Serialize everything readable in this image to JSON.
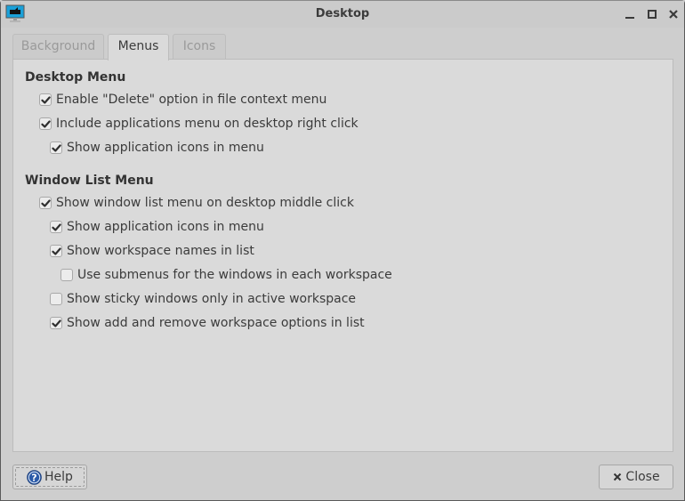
{
  "window": {
    "title": "Desktop",
    "app_icon": "desktop-monitor-icon",
    "controls": [
      "minimize-icon",
      "maximize-icon",
      "close-icon"
    ]
  },
  "tabs": [
    {
      "label": "Background",
      "active": false
    },
    {
      "label": "Menus",
      "active": true
    },
    {
      "label": "Icons",
      "active": false
    }
  ],
  "desktop_menu": {
    "title": "Desktop Menu",
    "options": [
      {
        "label": "Enable \"Delete\" option in file context menu",
        "checked": true
      },
      {
        "label": "Include applications menu on desktop right click",
        "checked": true
      },
      {
        "label": "Show application icons in menu",
        "checked": true
      }
    ]
  },
  "window_list_menu": {
    "title": "Window List Menu",
    "options": [
      {
        "label": "Show window list menu on desktop middle click",
        "checked": true
      },
      {
        "label": "Show application icons in menu",
        "checked": true
      },
      {
        "label": "Show workspace names in list",
        "checked": true
      },
      {
        "label": "Use submenus for the windows in each workspace",
        "checked": false
      },
      {
        "label": "Show sticky windows only in active workspace",
        "checked": false
      },
      {
        "label": "Show add and remove workspace options in list",
        "checked": true
      }
    ]
  },
  "buttons": {
    "help_label": "Help",
    "help_icon": "help-question-icon",
    "close_label": "Close",
    "close_icon": "close-x-icon"
  },
  "colors": {
    "window_bg": "#cecece",
    "panel_bg": "#dadada",
    "text": "#3b3b3b",
    "help_icon_blue": "#2a5aa8",
    "app_icon_cyan": "#1aa0d8"
  }
}
